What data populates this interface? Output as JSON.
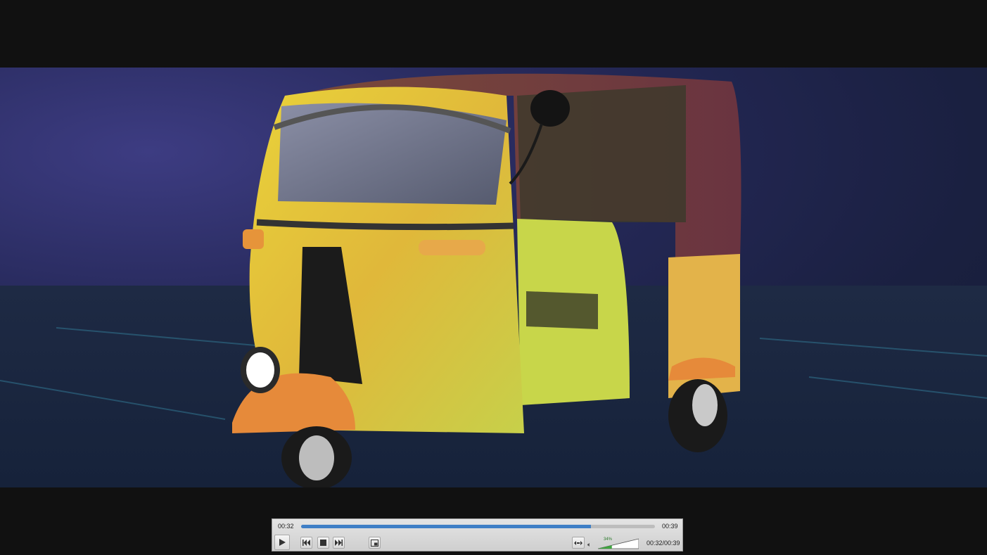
{
  "player": {
    "elapsed": "00:32",
    "duration": "00:39",
    "time_readout": "00:32/00:39",
    "progress_fraction": 0.82,
    "volume_label": "34%",
    "volume_fraction": 0.34
  },
  "icons": {
    "play": "play-icon",
    "prev": "skip-back-icon",
    "stop": "stop-icon",
    "next": "skip-forward-icon",
    "fullscreen": "picture-in-picture-icon",
    "aspect": "aspect-ratio-icon",
    "speaker": "speaker-icon"
  },
  "colors": {
    "letterbox": "#111111",
    "progress": "#3f7fc6",
    "volume": "#3fa53f"
  }
}
